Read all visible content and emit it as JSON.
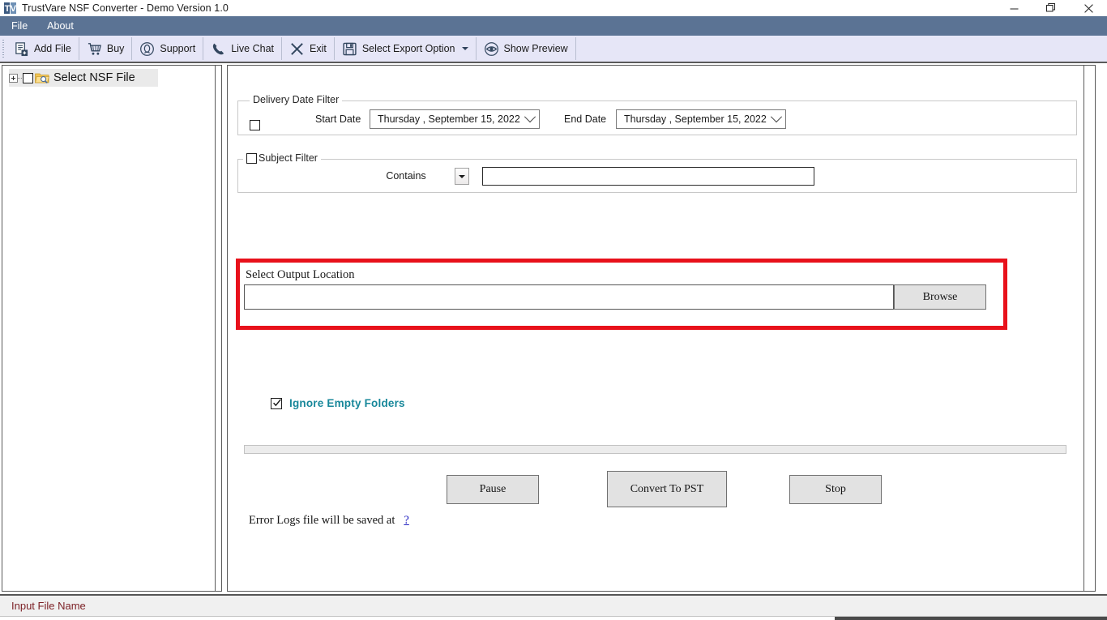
{
  "window": {
    "title": "TrustVare NSF Converter - Demo Version 1.0",
    "logo_text": "TV",
    "controls": {
      "minimize": "minimize-icon",
      "restore": "restore-icon",
      "close": "close-icon"
    }
  },
  "menubar": {
    "items": [
      {
        "label": "File"
      },
      {
        "label": "About"
      }
    ]
  },
  "toolbar": {
    "buttons": [
      {
        "label": "Add File",
        "icon": "add-file-icon"
      },
      {
        "label": "Buy",
        "icon": "cart-icon"
      },
      {
        "label": "Support",
        "icon": "headset-icon"
      },
      {
        "label": "Live Chat",
        "icon": "phone-icon"
      },
      {
        "label": "Exit",
        "icon": "close-x-icon"
      },
      {
        "label": "Select Export Option",
        "icon": "save-floppy-icon",
        "has_dropdown": true
      },
      {
        "label": "Show Preview",
        "icon": "eye-icon"
      }
    ]
  },
  "tree": {
    "root_label": "Select NSF File",
    "expander": "plus",
    "checked": false,
    "icon": "folder-search-icon"
  },
  "delivery_date_filter": {
    "legend": "Delivery Date Filter",
    "enabled": false,
    "start_label": "Start Date",
    "start_value": "Thursday  , September 15, 2022",
    "end_label": "End Date",
    "end_value": "Thursday  , September 15, 2022"
  },
  "subject_filter": {
    "legend": "Subject Filter",
    "enabled": false,
    "condition": "Contains",
    "value": "",
    "placeholder": ""
  },
  "output_location": {
    "legend": "Select Output Location",
    "path_value": "",
    "path_placeholder": "",
    "browse_label": "Browse",
    "highlight_color": "#e8111b"
  },
  "options": {
    "ignore_empty_folders_label": "Ignore Empty Folders",
    "ignore_empty_folders_checked": true,
    "accent_color": "#17879a"
  },
  "progress": {
    "value": 0
  },
  "actions": {
    "pause_label": "Pause",
    "convert_label": "Convert To PST",
    "stop_label": "Stop"
  },
  "error_logs": {
    "text": "Error Logs file will be saved at",
    "link_label": "?"
  },
  "statusbar": {
    "text": "Input File Name",
    "color": "#7b1f24"
  }
}
